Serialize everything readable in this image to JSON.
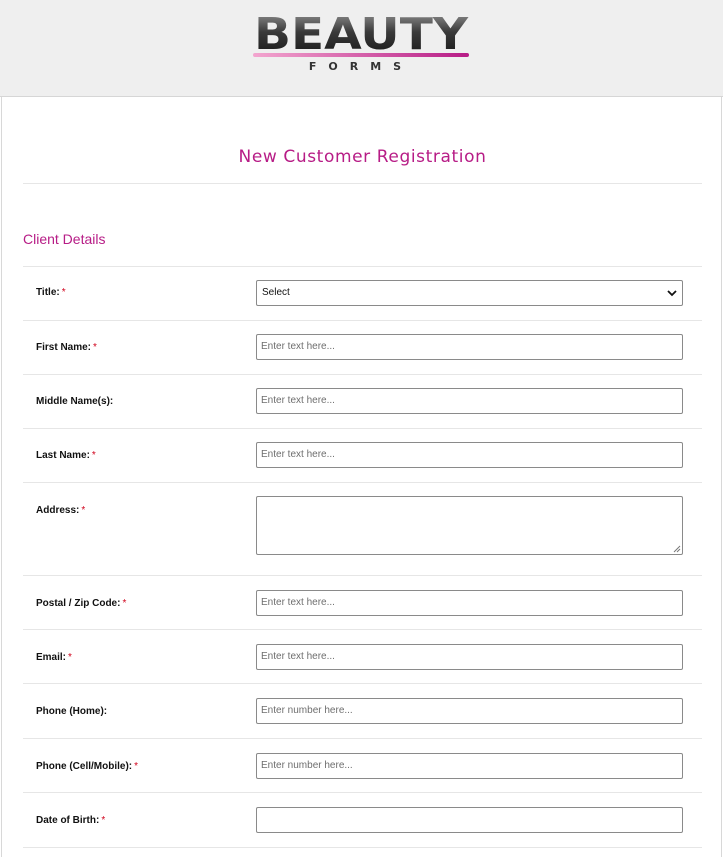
{
  "brand": {
    "logo_main": "BEAUTY",
    "logo_sub": "F O R M S",
    "accent_color": "#b71c86"
  },
  "form": {
    "title": "New Customer Registration",
    "section": "Client Details",
    "required_marker": "*",
    "fields": {
      "title": {
        "label": "Title:",
        "value": "Select",
        "options": [
          "Select"
        ]
      },
      "first_name": {
        "label": "First Name:",
        "placeholder": "Enter text here..."
      },
      "middle_name": {
        "label": "Middle Name(s):",
        "placeholder": "Enter text here..."
      },
      "last_name": {
        "label": "Last Name:",
        "placeholder": "Enter text here..."
      },
      "address": {
        "label": "Address:",
        "value": ""
      },
      "postal_code": {
        "label": "Postal / Zip Code:",
        "placeholder": "Enter text here..."
      },
      "email": {
        "label": "Email:",
        "placeholder": "Enter text here..."
      },
      "phone_home": {
        "label": "Phone (Home):",
        "placeholder": "Enter number here..."
      },
      "phone_cell": {
        "label": "Phone (Cell/Mobile):",
        "placeholder": "Enter number here..."
      },
      "dob": {
        "label": "Date of Birth:",
        "value": ""
      }
    }
  }
}
